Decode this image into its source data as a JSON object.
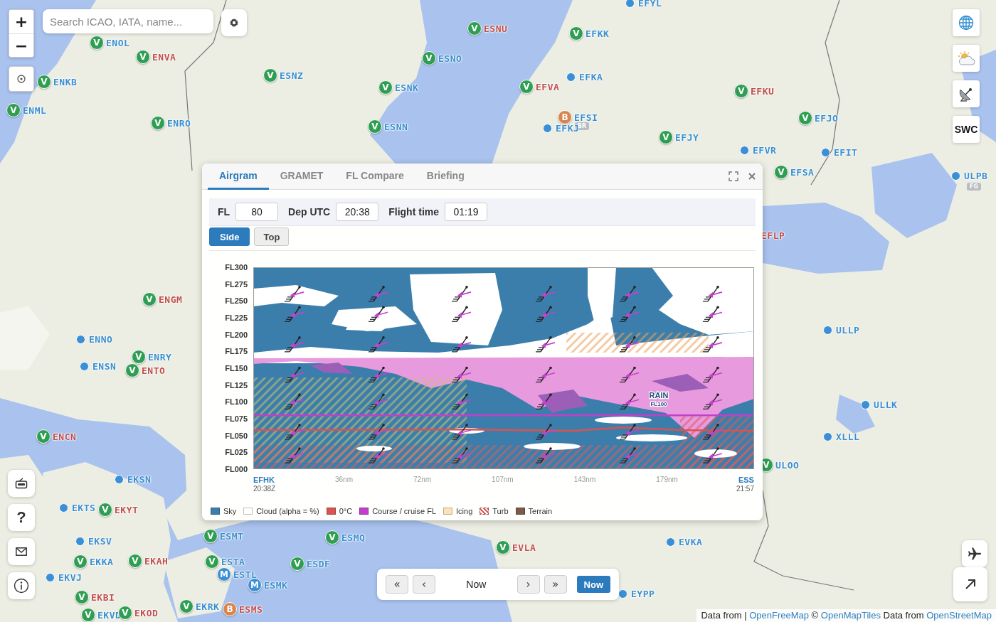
{
  "search": {
    "placeholder": "Search ICAO, IATA, name..."
  },
  "zoom_controls": [
    "+",
    "−"
  ],
  "map_markers": [
    {
      "code": "ENOL",
      "badge": "V",
      "kind": "vfr",
      "color": "#3a8fd0"
    },
    {
      "code": "ENVA",
      "badge": "V",
      "kind": "vfr",
      "color": "#c0504d"
    },
    {
      "code": "ENKB",
      "badge": "V",
      "kind": "vfr",
      "color": "#3a8fd0"
    },
    {
      "code": "ENML",
      "badge": "V",
      "kind": "vfr",
      "color": "#3a8fd0"
    },
    {
      "code": "ENRO",
      "badge": "V",
      "kind": "vfr",
      "color": "#3a8fd0"
    },
    {
      "code": "ESNZ",
      "badge": "V",
      "kind": "vfr",
      "color": "#3a8fd0"
    },
    {
      "code": "ESNO",
      "badge": "V",
      "kind": "vfr",
      "color": "#3a8fd0"
    },
    {
      "code": "ESNK",
      "badge": "V",
      "kind": "vfr",
      "color": "#3a8fd0"
    },
    {
      "code": "ESNN",
      "badge": "V",
      "kind": "vfr",
      "color": "#3a8fd0"
    },
    {
      "code": "ESNU",
      "badge": "V",
      "kind": "vfr",
      "color": "#c0504d"
    },
    {
      "code": "EFYL",
      "kind": "dot",
      "color": "#3a8fd0"
    },
    {
      "code": "EFKK",
      "badge": "V",
      "kind": "vfr",
      "color": "#3a8fd0"
    },
    {
      "code": "EFKA",
      "kind": "dot",
      "color": "#3a8fd0"
    },
    {
      "code": "EFVA",
      "badge": "V",
      "kind": "vfr",
      "color": "#c0504d"
    },
    {
      "code": "EFSI",
      "badge": "B",
      "kind": "b",
      "color": "#3a8fd0",
      "tag": "BR"
    },
    {
      "code": "EFKJ",
      "kind": "dot",
      "color": "#3a8fd0"
    },
    {
      "code": "EFKU",
      "badge": "V",
      "kind": "vfr",
      "color": "#c0504d"
    },
    {
      "code": "EFJO",
      "badge": "V",
      "kind": "vfr",
      "color": "#3a8fd0"
    },
    {
      "code": "EFJY",
      "badge": "V",
      "kind": "vfr",
      "color": "#3a8fd0"
    },
    {
      "code": "EFVR",
      "kind": "dot",
      "color": "#3a8fd0"
    },
    {
      "code": "EFIT",
      "kind": "dot",
      "color": "#3a8fd0"
    },
    {
      "code": "EFSA",
      "badge": "V",
      "kind": "vfr",
      "color": "#3a8fd0"
    },
    {
      "code": "ULPB",
      "kind": "dot",
      "color": "#3a8fd0",
      "tag": "FG"
    },
    {
      "code": "EFLP",
      "kind": "label",
      "color": "#c0504d"
    },
    {
      "code": "ULLP",
      "kind": "dot",
      "color": "#3a8fd0"
    },
    {
      "code": "ULLK",
      "kind": "dot",
      "color": "#3a8fd0"
    },
    {
      "code": "XLLL",
      "kind": "dot",
      "color": "#3a8fd0"
    },
    {
      "code": "ULOO",
      "badge": "V",
      "kind": "vfr",
      "color": "#3a8fd0"
    },
    {
      "code": "ENGM",
      "badge": "V",
      "kind": "vfr",
      "color": "#c0504d"
    },
    {
      "code": "ENNO",
      "kind": "dot",
      "color": "#3a8fd0"
    },
    {
      "code": "ENRY",
      "badge": "V",
      "kind": "vfr",
      "color": "#3a8fd0"
    },
    {
      "code": "ENSN",
      "kind": "dot",
      "color": "#3a8fd0"
    },
    {
      "code": "ENTO",
      "badge": "V",
      "kind": "vfr",
      "color": "#c0504d"
    },
    {
      "code": "ENCN",
      "badge": "V",
      "kind": "vfr",
      "color": "#c0504d"
    },
    {
      "code": "EKSN",
      "kind": "dot",
      "color": "#3a8fd0"
    },
    {
      "code": "EKTS",
      "kind": "dot",
      "color": "#3a8fd0"
    },
    {
      "code": "EKYT",
      "badge": "V",
      "kind": "vfr",
      "color": "#c0504d"
    },
    {
      "code": "EKSV",
      "kind": "dot",
      "color": "#3a8fd0"
    },
    {
      "code": "EKKA",
      "badge": "V",
      "kind": "vfr",
      "color": "#3a8fd0"
    },
    {
      "code": "EKAH",
      "badge": "V",
      "kind": "vfr",
      "color": "#c0504d"
    },
    {
      "code": "EKVJ",
      "kind": "dot",
      "color": "#3a8fd0"
    },
    {
      "code": "EKBI",
      "badge": "V",
      "kind": "vfr",
      "color": "#c0504d"
    },
    {
      "code": "EKVD",
      "badge": "V",
      "kind": "vfr",
      "color": "#3a8fd0"
    },
    {
      "code": "EKOD",
      "badge": "V",
      "kind": "vfr",
      "color": "#c0504d"
    },
    {
      "code": "ESMT",
      "badge": "V",
      "kind": "vfr",
      "color": "#3a8fd0"
    },
    {
      "code": "ESTA",
      "badge": "V",
      "kind": "vfr",
      "color": "#3a8fd0"
    },
    {
      "code": "ESTL",
      "badge": "M",
      "kind": "m",
      "color": "#3a8fd0"
    },
    {
      "code": "ESMK",
      "badge": "M",
      "kind": "m",
      "color": "#3a8fd0"
    },
    {
      "code": "EKRK",
      "badge": "V",
      "kind": "vfr",
      "color": "#3a8fd0"
    },
    {
      "code": "ESMS",
      "badge": "B",
      "kind": "b",
      "color": "#c0504d"
    },
    {
      "code": "ESMQ",
      "badge": "V",
      "kind": "vfr",
      "color": "#3a8fd0"
    },
    {
      "code": "ESDF",
      "badge": "V",
      "kind": "vfr",
      "color": "#3a8fd0"
    },
    {
      "code": "EVLA",
      "badge": "V",
      "kind": "vfr",
      "color": "#c0504d"
    },
    {
      "code": "EVKA",
      "kind": "dot",
      "color": "#3a8fd0"
    },
    {
      "code": "EYPP",
      "kind": "dot",
      "color": "#3a8fd0"
    }
  ],
  "right_buttons": [
    {
      "kind": "globe"
    },
    {
      "kind": "weather"
    },
    {
      "kind": "dish"
    },
    {
      "kind": "text",
      "label": "SWC"
    }
  ],
  "left_buttons": [
    {
      "kind": "tv"
    },
    {
      "kind": "text",
      "label": "?"
    },
    {
      "kind": "mail"
    },
    {
      "kind": "info"
    }
  ],
  "corner_buttons": [
    {
      "kind": "plane"
    },
    {
      "kind": "arrow"
    }
  ],
  "airgram_panel": {
    "tabs": [
      {
        "label": "Airgram",
        "selected": true
      },
      {
        "label": "GRAMET",
        "selected": false
      },
      {
        "label": "FL Compare",
        "selected": false
      },
      {
        "label": "Briefing",
        "selected": false
      }
    ],
    "fields": [
      {
        "label": "FL",
        "value": "80"
      },
      {
        "label": "Dep UTC",
        "value": "20:38"
      },
      {
        "label": "Flight time",
        "value": "01:19"
      }
    ],
    "views": [
      {
        "label": "Side",
        "selected": true
      },
      {
        "label": "Top",
        "selected": false
      }
    ],
    "chart": {
      "y_ticks": [
        "FL300",
        "FL275",
        "FL250",
        "FL225",
        "FL200",
        "FL175",
        "FL150",
        "FL125",
        "FL100",
        "FL075",
        "FL050",
        "FL025",
        "FL000"
      ],
      "start": {
        "code": "EFHK",
        "time": "20:38Z"
      },
      "x_labels": [
        "36nm",
        "72nm",
        "107nm",
        "143nm",
        "179nm"
      ],
      "end": {
        "code": "ESS",
        "time": "21:57"
      },
      "annotations": [
        "RAIN",
        "FL100"
      ]
    },
    "legend": [
      {
        "label": "Sky",
        "color": "#3b7eab",
        "kind": "solid"
      },
      {
        "label": "Cloud (alpha = %)",
        "color": "#ffffff",
        "kind": "solid"
      },
      {
        "label": "0°C",
        "color": "#d9534f",
        "kind": "solid"
      },
      {
        "label": "Course / cruise FL",
        "color": "#c13fc9",
        "kind": "solid"
      },
      {
        "label": "Icing",
        "color": "#fbe3b8",
        "kind": "solid"
      },
      {
        "label": "Turb",
        "color": "#e05a5a",
        "kind": "hatch"
      },
      {
        "label": "Terrain",
        "color": "#7a5a48",
        "kind": "solid"
      }
    ]
  },
  "time_bar": {
    "before": [
      "«",
      "‹"
    ],
    "label": "Now",
    "after": [
      "›",
      "»"
    ],
    "now_button": "Now"
  },
  "attribution": [
    {
      "kind": "text",
      "text": "Data from |"
    },
    {
      "kind": "link",
      "text": "OpenFreeMap"
    },
    {
      "kind": "text",
      "text": "©"
    },
    {
      "kind": "link",
      "text": "OpenMapTiles"
    },
    {
      "kind": "text",
      "text": "Data from"
    },
    {
      "kind": "link",
      "text": "OpenStreetMap"
    }
  ]
}
